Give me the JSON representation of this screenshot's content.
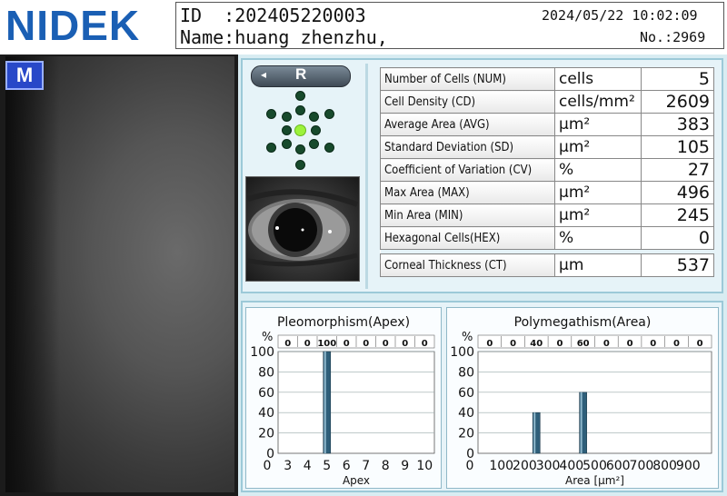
{
  "header": {
    "logo_text": "NIDEK",
    "id_label": "ID  :202405220003",
    "datetime": "2024/05/22 10:02:09",
    "name_label": "Name:huang zhenzhu,",
    "number_label": "No.:2969"
  },
  "image_panel": {
    "mode_badge": "M"
  },
  "eye_selector": {
    "label": "R",
    "arrow": "◂"
  },
  "fixation_grid": {
    "active_dot": "center-left"
  },
  "stats": {
    "rows": [
      {
        "label": "Number of Cells (NUM)",
        "unit": "cells",
        "value": "5"
      },
      {
        "label": "Cell Density (CD)",
        "unit": "cells/mm²",
        "value": "2609"
      },
      {
        "label": "Average Area (AVG)",
        "unit": "µm²",
        "value": "383"
      },
      {
        "label": "Standard Deviation (SD)",
        "unit": "µm²",
        "value": "105"
      },
      {
        "label": "Coefficient of Variation (CV)",
        "unit": "%",
        "value": "27"
      },
      {
        "label": "Max Area (MAX)",
        "unit": "µm²",
        "value": "496"
      },
      {
        "label": "Min Area (MIN)",
        "unit": "µm²",
        "value": "245"
      },
      {
        "label": "Hexagonal Cells(HEX)",
        "unit": "%",
        "value": "0"
      }
    ],
    "thickness": {
      "label": "Corneal Thickness (CT)",
      "unit": "µm",
      "value": "537"
    }
  },
  "colors": {
    "bar_fill": "#2f5f7a",
    "panel_bg": "#e6f3f8",
    "logo_blue": "#1a5fb4"
  },
  "chart_data": [
    {
      "type": "bar",
      "title": "Pleomorphism(Apex)",
      "xlabel": "Apex",
      "ylabel": "%",
      "ylim": [
        0,
        100
      ],
      "yticks": [
        "0",
        "20",
        "40",
        "60",
        "80",
        "100"
      ],
      "categories": [
        "3",
        "4",
        "5",
        "6",
        "7",
        "8",
        "9",
        "10"
      ],
      "top_values": [
        "0",
        "0",
        "100",
        "0",
        "0",
        "0",
        "0",
        "0"
      ],
      "values": [
        0,
        0,
        100,
        0,
        0,
        0,
        0,
        0
      ]
    },
    {
      "type": "bar",
      "title": "Polymegathism(Area)",
      "xlabel": "Area [µm²]",
      "ylabel": "%",
      "ylim": [
        0,
        100
      ],
      "yticks": [
        "0",
        "20",
        "40",
        "60",
        "80",
        "100"
      ],
      "categories": [
        "100",
        "200",
        "300",
        "400",
        "500",
        "600",
        "700",
        "800",
        "900"
      ],
      "top_values": [
        "0",
        "0",
        "40",
        "0",
        "60",
        "0",
        "0",
        "0",
        "0",
        "0"
      ],
      "bar_positions": [
        250,
        450
      ],
      "bar_values": [
        40,
        60
      ]
    }
  ]
}
